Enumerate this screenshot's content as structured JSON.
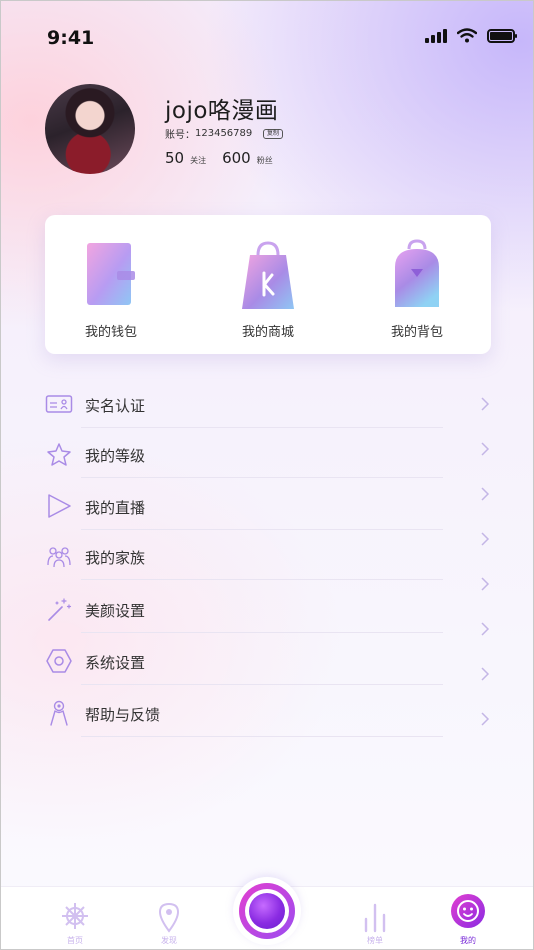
{
  "status_bar": {
    "time": "9:41"
  },
  "profile": {
    "name": "jojo咯漫画",
    "account_label": "账号：",
    "account_id": "123456789",
    "copy_label": "复制",
    "following_count": "50",
    "following_label": "关注",
    "fans_count": "600",
    "fans_label": "粉丝"
  },
  "quick_actions": [
    {
      "label": "我的钱包",
      "icon": "wallet-icon"
    },
    {
      "label": "我的商城",
      "icon": "shopping-bag-icon"
    },
    {
      "label": "我的背包",
      "icon": "backpack-icon"
    }
  ],
  "menu": [
    {
      "label": "实名认证",
      "icon": "id-card-icon"
    },
    {
      "label": "我的等级",
      "icon": "star-icon"
    },
    {
      "label": "我的直播",
      "icon": "play-icon"
    },
    {
      "label": "我的家族",
      "icon": "family-icon"
    },
    {
      "label": "美颜设置",
      "icon": "magic-wand-icon"
    },
    {
      "label": "系统设置",
      "icon": "hexagon-settings-icon"
    },
    {
      "label": "帮助与反馈",
      "icon": "help-person-icon"
    }
  ],
  "tab_bar": {
    "tabs": [
      {
        "label": "首页",
        "icon": "helm-icon"
      },
      {
        "label": "发现",
        "icon": "location-pin-icon"
      },
      {
        "label": "榜单",
        "icon": "bar-chart-icon"
      },
      {
        "label": "我的",
        "icon": "smiley-face-icon"
      }
    ],
    "center_icon": "camera-live-icon"
  },
  "colors": {
    "accent": "#9b4cf0",
    "icon_purple": "#a98be6",
    "tab_inactive": "#c8b3ec"
  }
}
